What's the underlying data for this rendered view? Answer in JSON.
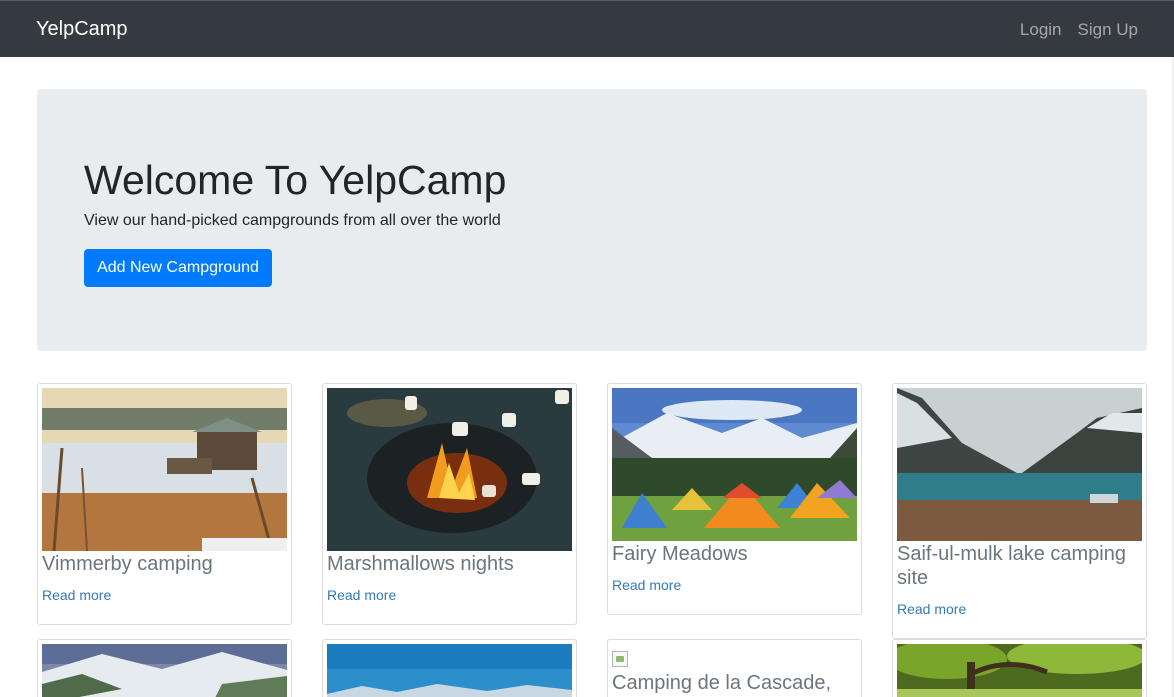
{
  "navbar": {
    "brand": "YelpCamp",
    "links": {
      "login": "Login",
      "signup": "Sign Up"
    }
  },
  "jumbotron": {
    "title": "Welcome To YelpCamp",
    "lead": "View our hand-picked campgrounds from all over the world",
    "button": "Add New Campground"
  },
  "campgrounds": [
    {
      "name": "Vimmerby camping",
      "link": "Read more",
      "image": "lake-cabin-sunset"
    },
    {
      "name": "Marshmallows nights",
      "link": "Read more",
      "image": "campfire-marshmallows"
    },
    {
      "name": "Fairy Meadows",
      "link": "Read more",
      "image": "tents-mountain-meadow"
    },
    {
      "name": "Saif-ul-mulk lake camping site",
      "link": "Read more",
      "image": "mountain-lake"
    },
    {
      "name": "",
      "link": "",
      "image": "snowy-valley"
    },
    {
      "name": "",
      "link": "",
      "image": "blue-sky-mountains"
    },
    {
      "name": "Camping de la Cascade,",
      "link": "",
      "image": "broken-image"
    },
    {
      "name": "",
      "link": "",
      "image": "green-forest"
    }
  ],
  "colors": {
    "navbar": "#343a40",
    "primary": "#007bff",
    "jumbotron": "#e9ecef",
    "link": "#337ab7"
  }
}
